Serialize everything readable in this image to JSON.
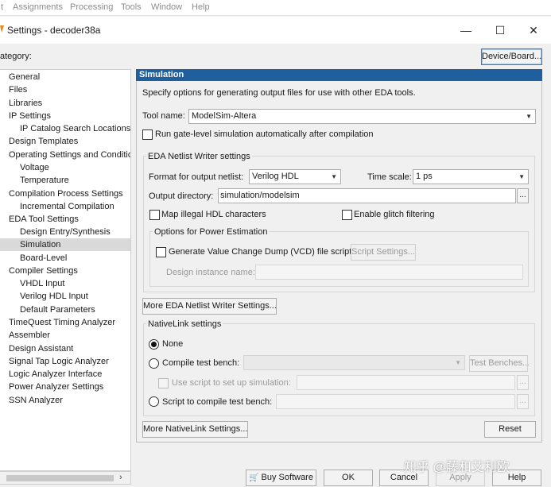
{
  "menubar": {
    "items": [
      "t",
      "Assignments",
      "Processing",
      "Tools",
      "Window",
      "Help"
    ]
  },
  "window": {
    "title": "Settings - decoder38a",
    "minimize": "—",
    "maximize": "☐",
    "close": "✕"
  },
  "sidebar": {
    "label": "ategory:",
    "items": [
      {
        "label": "General"
      },
      {
        "label": "Files"
      },
      {
        "label": "Libraries"
      },
      {
        "label": "IP Settings"
      },
      {
        "label": "IP Catalog Search Locations"
      },
      {
        "label": "Design Templates"
      },
      {
        "label": "Operating Settings and Conditions"
      },
      {
        "label": "Voltage"
      },
      {
        "label": "Temperature"
      },
      {
        "label": "Compilation Process Settings"
      },
      {
        "label": "Incremental Compilation"
      },
      {
        "label": "EDA Tool Settings"
      },
      {
        "label": "Design Entry/Synthesis"
      },
      {
        "label": "Simulation"
      },
      {
        "label": "Board-Level"
      },
      {
        "label": "Compiler Settings"
      },
      {
        "label": "VHDL Input"
      },
      {
        "label": "Verilog HDL Input"
      },
      {
        "label": "Default Parameters"
      },
      {
        "label": "TimeQuest Timing Analyzer"
      },
      {
        "label": "Assembler"
      },
      {
        "label": "Design Assistant"
      },
      {
        "label": "Signal Tap Logic Analyzer"
      },
      {
        "label": "Logic Analyzer Interface"
      },
      {
        "label": "Power Analyzer Settings"
      },
      {
        "label": "SSN Analyzer"
      }
    ],
    "scroll_right": "›"
  },
  "main": {
    "device_board_button": "Device/Board...",
    "section_title": "Simulation",
    "description": "Specify options for generating output files for use with other EDA tools.",
    "tool_name_label": "Tool name:",
    "tool_name_value": "ModelSim-Altera",
    "gate_level_label": "Run gate-level simulation automatically after compilation",
    "netlist_group_title": "EDA Netlist Writer settings",
    "format_label": "Format for output netlist:",
    "format_value": "Verilog HDL",
    "timescale_label": "Time scale:",
    "timescale_value": "1 ps",
    "output_dir_label": "Output directory:",
    "output_dir_value": "simulation/modelsim",
    "browse_label": "...",
    "map_illegal_label": "Map illegal HDL characters",
    "glitch_label": "Enable glitch filtering",
    "power_group_title": "Options for Power Estimation",
    "vcd_label": "Generate Value Change Dump (VCD) file script",
    "script_settings_button": "Script Settings...",
    "instance_name_label": "Design instance name:",
    "more_netlist_button": "More EDA Netlist Writer Settings...",
    "nativelink_group_title": "NativeLink settings",
    "radio_none": "None",
    "radio_compile_tb": "Compile test bench:",
    "test_benches_button": "Test Benches...",
    "use_script_label": "Use script to set up simulation:",
    "radio_script_compile": "Script to compile test bench:",
    "more_nativelink_button": "More NativeLink Settings...",
    "reset_button": "Reset"
  },
  "footer": {
    "buy_software": "Buy Software",
    "ok": "OK",
    "cancel": "Cancel",
    "apply": "Apply",
    "help": "Help"
  },
  "watermark": "知乎 @藤和艾利欧",
  "colors": {
    "section_header": "#1f5f9e",
    "selected_row": "#d9d9d9"
  }
}
